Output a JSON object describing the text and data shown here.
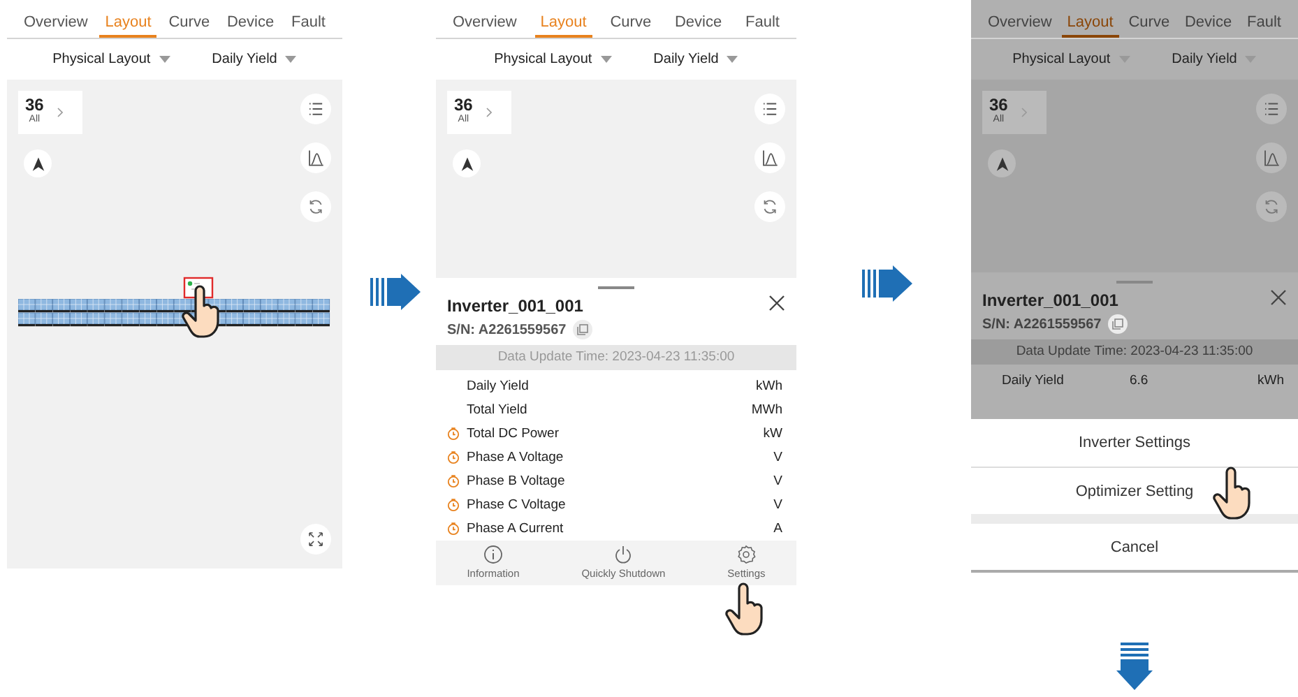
{
  "screens": [
    {
      "kind": "map",
      "dimmed": false,
      "tabs": [
        {
          "label": "Overview",
          "selected": false
        },
        {
          "label": "Layout",
          "selected": true
        },
        {
          "label": "Curve",
          "selected": false
        },
        {
          "label": "Device",
          "selected": false
        },
        {
          "label": "Fault",
          "selected": false
        }
      ],
      "filters": [
        "Physical Layout",
        "Daily Yield"
      ],
      "counter": {
        "value": "36",
        "label": "All"
      },
      "marker_selected": true
    },
    {
      "kind": "detail",
      "dimmed": false,
      "tabs": [
        {
          "label": "Overview",
          "selected": false
        },
        {
          "label": "Layout",
          "selected": true
        },
        {
          "label": "Curve",
          "selected": false
        },
        {
          "label": "Device",
          "selected": false
        },
        {
          "label": "Fault",
          "selected": false
        }
      ],
      "filters": [
        "Physical Layout",
        "Daily Yield"
      ],
      "counter": {
        "value": "36",
        "label": "All"
      },
      "sheet": {
        "title": "Inverter_001_001",
        "serial": "S/N: A2261559567",
        "update_time": "Data Update Time: 2023-04-23 11:35:00",
        "rows": [
          {
            "label": "Daily Yield",
            "unit": "kWh",
            "timer": false
          },
          {
            "label": "Total Yield",
            "unit": "MWh",
            "timer": false
          },
          {
            "label": "Total DC Power",
            "unit": "kW",
            "timer": true
          },
          {
            "label": "Phase A Voltage",
            "unit": "V",
            "timer": true
          },
          {
            "label": "Phase B Voltage",
            "unit": "V",
            "timer": true
          },
          {
            "label": "Phase C Voltage",
            "unit": "V",
            "timer": true
          },
          {
            "label": "Phase A Current",
            "unit": "A",
            "timer": true
          }
        ],
        "actions": [
          {
            "kind": "info",
            "label": "Information"
          },
          {
            "kind": "power",
            "label": "Quickly Shutdown"
          },
          {
            "kind": "settings",
            "label": "Settings"
          }
        ]
      }
    },
    {
      "kind": "action-sheet",
      "dimmed": true,
      "tabs": [
        {
          "label": "Overview",
          "selected": false
        },
        {
          "label": "Layout",
          "selected": true
        },
        {
          "label": "Curve",
          "selected": false
        },
        {
          "label": "Device",
          "selected": false
        },
        {
          "label": "Fault",
          "selected": false
        }
      ],
      "filters": [
        "Physical Layout",
        "Daily Yield"
      ],
      "counter": {
        "value": "36",
        "label": "All"
      },
      "sheet": {
        "title": "Inverter_001_001",
        "serial": "S/N: A2261559567",
        "update_time": "Data Update Time: 2023-04-23 11:35:00",
        "rows": [
          {
            "label": "Daily Yield",
            "value": "6.6",
            "unit": "kWh",
            "timer": false
          }
        ]
      },
      "menu": [
        {
          "label": "Inverter Settings"
        },
        {
          "label": "Optimizer Setting"
        },
        {
          "label": "Cancel"
        }
      ]
    }
  ]
}
